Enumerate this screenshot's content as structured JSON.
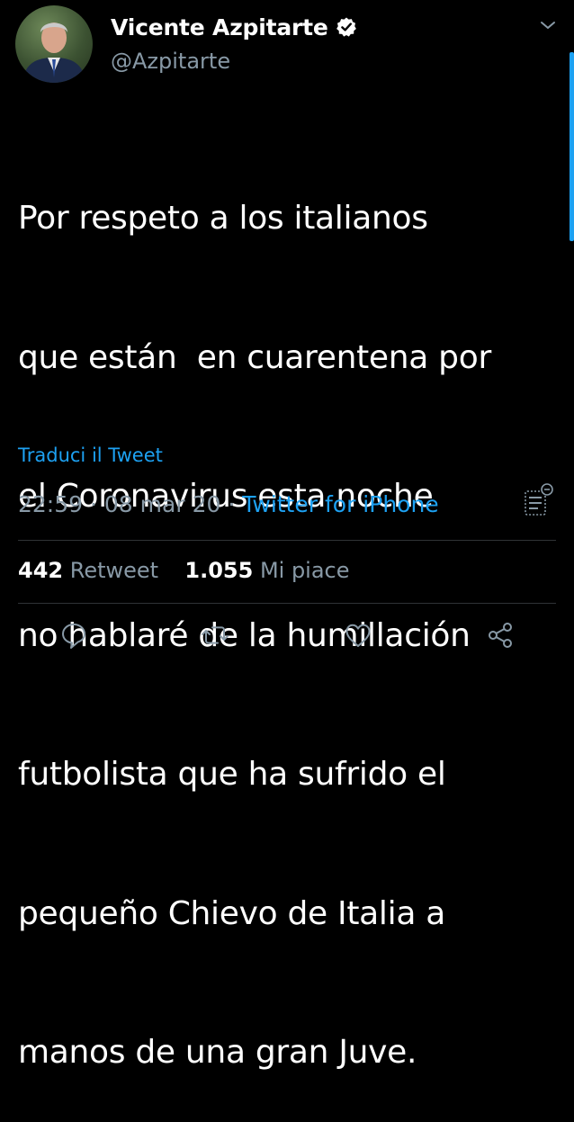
{
  "author": {
    "name": "Vicente Azpitarte",
    "handle": "@Azpitarte",
    "verified": true,
    "avatar_icon": "profile-photo"
  },
  "tweet": {
    "text_lines": [
      "Por respeto a los italianos",
      "que están  en cuarentena por",
      "el Coronavirus esta noche",
      "no hablaré de la humillación",
      "futbolista que ha sufrido el",
      "pequeño Chievo de Italia a",
      "manos de una gran Juve."
    ],
    "translate_label": "Traduci il Tweet",
    "time": "22:59",
    "date": "08 mar 20",
    "separator": "·",
    "source": "Twitter for iPhone"
  },
  "stats": {
    "retweets_count": "442",
    "retweets_label": "Retweet",
    "likes_count": "1.055",
    "likes_label": "Mi piace"
  },
  "actions": {
    "icons": [
      "reply-icon",
      "retweet-icon",
      "like-icon",
      "share-icon"
    ]
  },
  "colors": {
    "background": "#000000",
    "text": "#ffffff",
    "secondary": "#8899a6",
    "accent": "#1da1f2",
    "divider": "#2f3336"
  }
}
